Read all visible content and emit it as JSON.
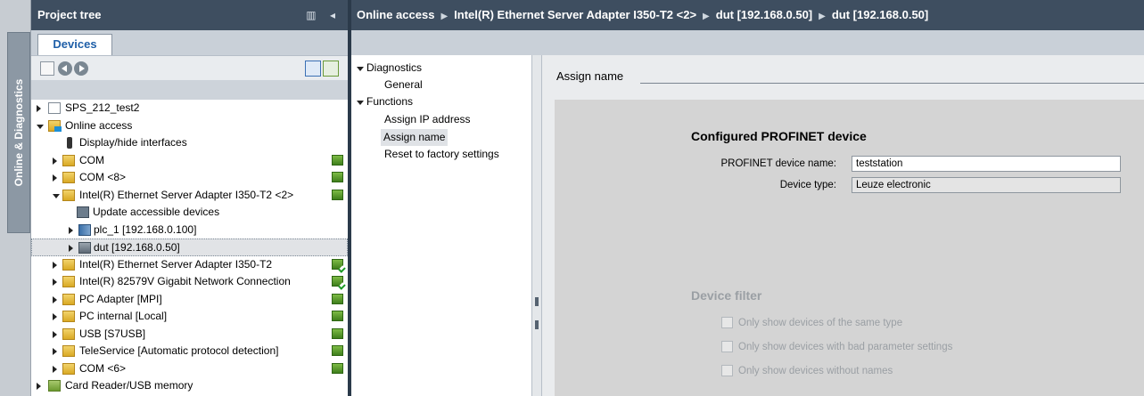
{
  "side_tab": {
    "label": "Online & Diagnostics"
  },
  "project_tree": {
    "header": "Project tree",
    "tab": "Devices",
    "rows": [
      {
        "label": "SPS_212_test2",
        "icon": "project-icon"
      },
      {
        "label": "Online access",
        "icon": "online-access-icon"
      },
      {
        "label": "Display/hide interfaces",
        "icon": "plug-icon"
      },
      {
        "label": "COM",
        "icon": "folder-icon"
      },
      {
        "label": "COM <8>",
        "icon": "folder-icon"
      },
      {
        "label": "Intel(R) Ethernet Server Adapter I350-T2 <2>",
        "icon": "folder-icon"
      },
      {
        "label": "Update accessible devices",
        "icon": "network-icon"
      },
      {
        "label": "plc_1 [192.168.0.100]",
        "icon": "plc-icon"
      },
      {
        "label": "dut [192.168.0.50]",
        "icon": "device-icon"
      },
      {
        "label": "Intel(R) Ethernet Server Adapter I350-T2",
        "icon": "folder-icon"
      },
      {
        "label": "Intel(R) 82579V Gigabit Network Connection",
        "icon": "folder-icon"
      },
      {
        "label": "PC Adapter [MPI]",
        "icon": "folder-icon"
      },
      {
        "label": "PC internal [Local]",
        "icon": "folder-icon"
      },
      {
        "label": "USB [S7USB]",
        "icon": "folder-icon"
      },
      {
        "label": "TeleService [Automatic protocol detection]",
        "icon": "folder-icon"
      },
      {
        "label": "COM <6>",
        "icon": "folder-icon"
      },
      {
        "label": "Card Reader/USB memory",
        "icon": "card-reader-icon"
      }
    ]
  },
  "breadcrumb": {
    "items": [
      "Online access",
      "Intel(R) Ethernet Server Adapter I350-T2 <2>",
      "dut [192.168.0.50]",
      "dut [192.168.0.50]"
    ]
  },
  "nav": {
    "diagnostics": "Diagnostics",
    "general": "General",
    "functions": "Functions",
    "assign_ip": "Assign IP address",
    "assign_name": "Assign name",
    "reset": "Reset to factory settings"
  },
  "content": {
    "section_title": "Assign name",
    "configured_title": "Configured PROFINET device",
    "device_name_label": "PROFINET device name:",
    "device_name_value": "teststation",
    "device_type_label": "Device type:",
    "device_type_value": "Leuze electronic",
    "filter_title": "Device filter",
    "filters": [
      "Only show devices of the same type",
      "Only show devices with bad parameter settings",
      "Only show devices without names"
    ]
  }
}
